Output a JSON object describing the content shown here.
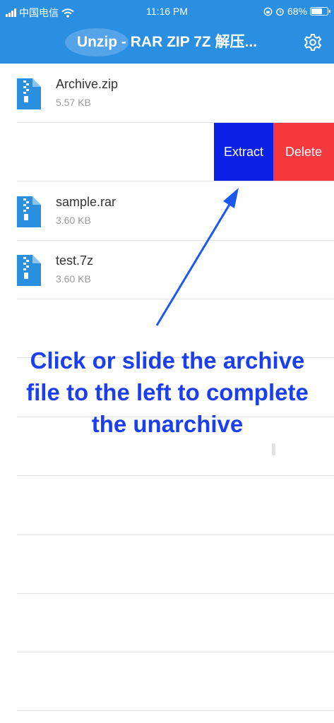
{
  "status_bar": {
    "carrier": "中国电信",
    "time": "11:16 PM",
    "battery": "68%",
    "battery_level": 0.68
  },
  "header": {
    "title": "Unzip - RAR ZIP 7Z 解压...",
    "settings_icon": "gear-icon",
    "background": "#2a8fe0"
  },
  "files": [
    {
      "name": "Archive.zip",
      "size": "5.57 KB",
      "icon": "zip-file-icon"
    },
    {
      "name": "sample.rar",
      "size": "3.60 KB",
      "icon": "zip-file-icon"
    },
    {
      "name": "test.7z",
      "size": "3.60 KB",
      "icon": "zip-file-icon"
    }
  ],
  "swipe_actions": {
    "extract_label": "Extract",
    "delete_label": "Delete",
    "extract_color": "#0b22e6",
    "delete_color": "#f5393f"
  },
  "hint": {
    "lines": [
      "Click or slide the archive",
      "file to the left to complete",
      "the unarchive"
    ],
    "color": "#1a3ef0"
  }
}
